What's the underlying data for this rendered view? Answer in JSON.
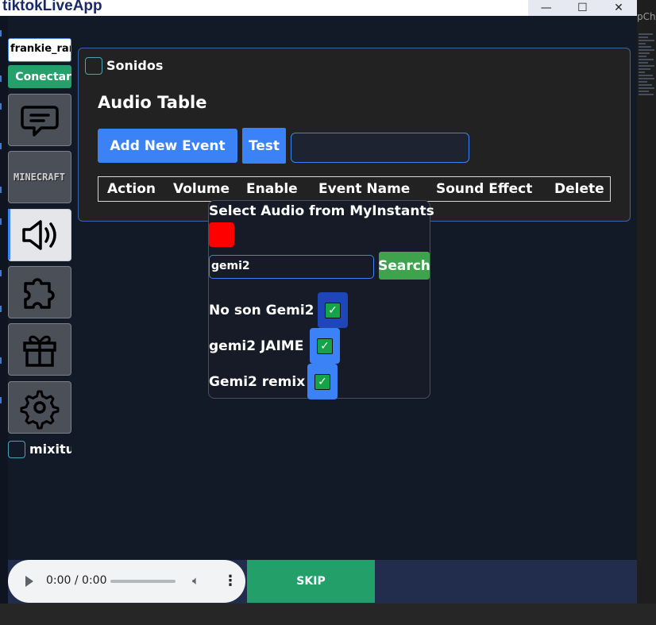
{
  "window": {
    "title": "tiktokLiveApp",
    "controls": {
      "minimize": "—",
      "maximize": "☐",
      "close": "✕"
    }
  },
  "background": {
    "editor_tab_fragment": "pCh"
  },
  "sidebar": {
    "username_value": "frankie_rar",
    "connect_label": "Conectar",
    "nav_items": [
      {
        "id": "chat",
        "icon": "chat-bubble-icon"
      },
      {
        "id": "minecraft",
        "icon": "minecraft-logo",
        "logo_text": "MINECRAFT"
      },
      {
        "id": "sound",
        "icon": "speaker-icon",
        "active": true
      },
      {
        "id": "plugins",
        "icon": "puzzle-icon"
      },
      {
        "id": "gifts",
        "icon": "gift-icon"
      },
      {
        "id": "settings",
        "icon": "gear-icon"
      }
    ],
    "mix_label": "mixitup"
  },
  "panel": {
    "checkbox_label": "Sonidos",
    "heading": "Audio Table",
    "add_button": "Add New Event",
    "test_button": "Test",
    "test_input_value": "",
    "table_headers": [
      "Action",
      "Volume",
      "Enable",
      "Event Name",
      "Sound Effect",
      "Delete"
    ]
  },
  "dropdown": {
    "title": "Select Audio from MyInstants",
    "search_value": "gemi2",
    "search_button": "Search",
    "results": [
      {
        "label": "No son Gemi2",
        "checked": true,
        "button_color": "#1f46b8"
      },
      {
        "label": "gemi2 JAIME",
        "checked": true,
        "button_color": "#3b82f6"
      },
      {
        "label": "Gemi2 remix",
        "checked": true,
        "button_color": "#3b82f6"
      }
    ]
  },
  "player": {
    "time": "0:00 / 0:00",
    "skip_label": "SKIP"
  },
  "colors": {
    "accent_blue": "#3b82f6",
    "success_green": "#23a06a",
    "search_green": "#3fa34d",
    "panel_bg": "#222222",
    "app_bg": "#121a27"
  }
}
